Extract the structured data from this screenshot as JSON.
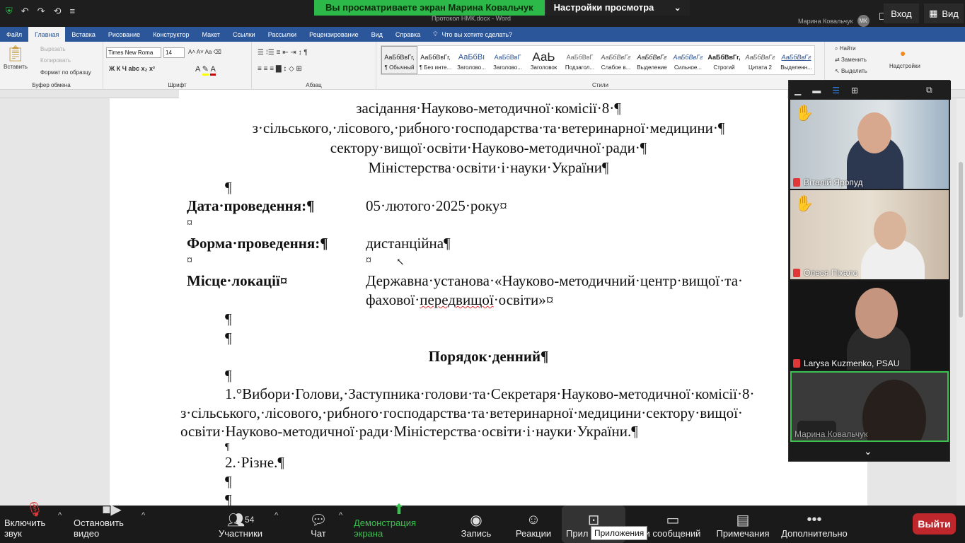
{
  "zoom": {
    "banner_text": "Вы просматриваете экран Марина Ковальчук",
    "view_settings": "Настройки просмотра",
    "enter_label": "Вход",
    "view_label": "Вид",
    "participants_count": "54",
    "toolbar": {
      "mute": "Включить звук",
      "video": "Остановить видео",
      "participants": "Участники",
      "chat": "Чат",
      "share": "Демонстрация экрана",
      "record": "Запись",
      "reactions": "Реакции",
      "apps": "Прил",
      "messages": "и сообщений",
      "notes": "Примечания",
      "more": "Дополнительно",
      "exit": "Выйти",
      "apps_tooltip": "Приложения"
    },
    "gallery": [
      {
        "name": "Віталій Яропуд",
        "muted": true,
        "hand": true
      },
      {
        "name": "Олеся Піхало",
        "muted": true,
        "hand": true
      },
      {
        "name": "Larysa Kuzmenko, PSAU",
        "muted": true,
        "hand": false
      },
      {
        "name": "Марина Ковальчук",
        "muted": false,
        "hand": false
      }
    ]
  },
  "word": {
    "doc_title": "Протокол НМК.docx - Word",
    "user_name": "Марина Ковальчук",
    "user_initials": "МК",
    "menu": [
      "Файл",
      "Главная",
      "Вставка",
      "Рисование",
      "Конструктор",
      "Макет",
      "Ссылки",
      "Рассылки",
      "Рецензирование",
      "Вид",
      "Справка"
    ],
    "help_search": "Что вы хотите сделать?",
    "ribbon": {
      "paste": "Вставить",
      "cut": "Вырезать",
      "copy": "Копировать",
      "format_painter": "Формат по образцу",
      "clipboard_group": "Буфер обмена",
      "font_group": "Шрифт",
      "paragraph_group": "Абзац",
      "styles_group": "Стили",
      "font_name": "Times New Roma",
      "font_size": "14",
      "find": "Найти",
      "replace": "Заменить",
      "select": "Выделить",
      "addins": "Надстройки",
      "styles": [
        {
          "preview": "АаБбВвГг,",
          "name": "¶ Обычный"
        },
        {
          "preview": "АаБбВвГг,",
          "name": "¶ Без инте..."
        },
        {
          "preview": "АаБбВı",
          "name": "Заголово..."
        },
        {
          "preview": "АаБбВвГ",
          "name": "Заголово..."
        },
        {
          "preview": "АаЬ",
          "name": "Заголовок"
        },
        {
          "preview": "АаБбВвГ",
          "name": "Подзагол..."
        },
        {
          "preview": "АаБбВвГг",
          "name": "Слабое в..."
        },
        {
          "preview": "АаБбВвГг",
          "name": "Выделение"
        },
        {
          "preview": "АаБбВвГг",
          "name": "Сильное..."
        },
        {
          "preview": "АаБбВвГг,",
          "name": "Строгий"
        },
        {
          "preview": "АаБбВвГг",
          "name": "Цитата 2"
        },
        {
          "preview": "АаБбВвГг",
          "name": "Выделенн..."
        }
      ]
    },
    "document": {
      "header1": "засідання·Науково-методичної·комісії·8·¶",
      "header2": "з·сільського,·лісового,·рибного·господарства·та·ветеринарної·медицини·¶",
      "header3": "сектору·вищої·освіти·Науково-методичної·ради·¶",
      "header4": "Міністерства·освіти·і·науки·України¶",
      "pilcrow": "¶",
      "cellmark": "¤",
      "date_label": "Дата·проведення:¶",
      "date_value": "05·лютого·2025·року¤",
      "form_label": "Форма·проведення:¶",
      "form_value": "дистанційна¶",
      "place_label": "Місце·локації¤",
      "place_value_1": "Державна·установа·«Науково-методичний·центр·вищої·та·",
      "place_value_2a": "фахової·",
      "place_value_2b": "передвищої",
      "place_value_2c": "·освіти»¤",
      "agenda_title": "Порядок·денний¶",
      "item1_line1": "1.°Вибори·Голови,·Заступника·голови·та·Секретаря·Науково-методичної·комісії·8·",
      "item1_line2": "з·сільського,·лісового,·рибного·господарства·та·ветеринарної·медицини·сектору·вищої·",
      "item1_line3": "освіти·Науково-методичної·ради·Міністерства·освіти·і·науки·України.¶",
      "item2": "2.·Різне.¶"
    }
  }
}
